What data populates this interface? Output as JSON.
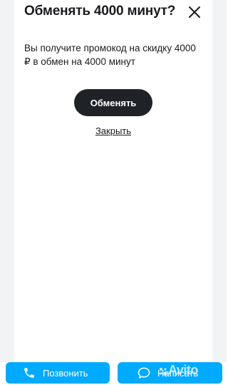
{
  "dialog": {
    "title": "Обменять 4000 минут?",
    "description": "Вы получите промокод на скидку 4000 ₽ в обмен на 4000 минут",
    "primary_label": "Обменять",
    "secondary_label": "Закрыть",
    "close_icon": "close-icon"
  },
  "bottom_bar": {
    "call_label": "Позвонить",
    "call_icon": "phone-icon",
    "write_label": "Написать",
    "write_icon": "chat-icon"
  },
  "watermark": {
    "text": "Avito"
  },
  "colors": {
    "accent": "#00aaff",
    "primary_button": "#1f2328",
    "text": "#1b1b1f"
  }
}
